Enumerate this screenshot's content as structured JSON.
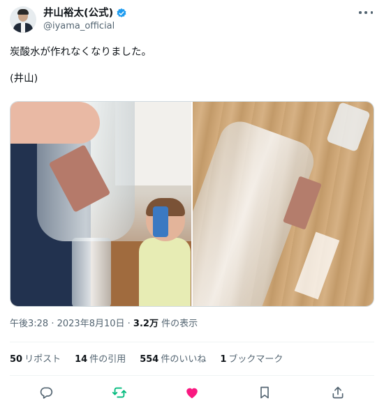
{
  "author": {
    "display_name": "井山裕太(公式)",
    "handle": "@iyama_official",
    "verified": true
  },
  "tweet": {
    "line1": "炭酸水が作れなくなりました。",
    "line2": "(井山)"
  },
  "media": {
    "count": 2,
    "items": [
      "photo",
      "photo"
    ]
  },
  "meta": {
    "time": "午後3:28",
    "separator": " · ",
    "date": "2023年8月10日",
    "separator2": " · ",
    "views_count": "3.2万",
    "views_label": " 件の表示"
  },
  "stats": {
    "reposts_count": "50",
    "reposts_label": "リポスト",
    "quotes_count": "14",
    "quotes_label": "件の引用",
    "likes_count": "554",
    "likes_label": "件のいいね",
    "bookmarks_count": "1",
    "bookmarks_label": "ブックマーク"
  },
  "icons": {
    "reply": "reply-icon",
    "repost": "repost-icon",
    "like": "like-icon",
    "bookmark": "bookmark-icon",
    "share": "share-icon"
  },
  "colors": {
    "verified": "#1d9bf0",
    "repost_active": "#00ba7c",
    "like_active": "#f91880",
    "secondary_text": "#536471"
  }
}
